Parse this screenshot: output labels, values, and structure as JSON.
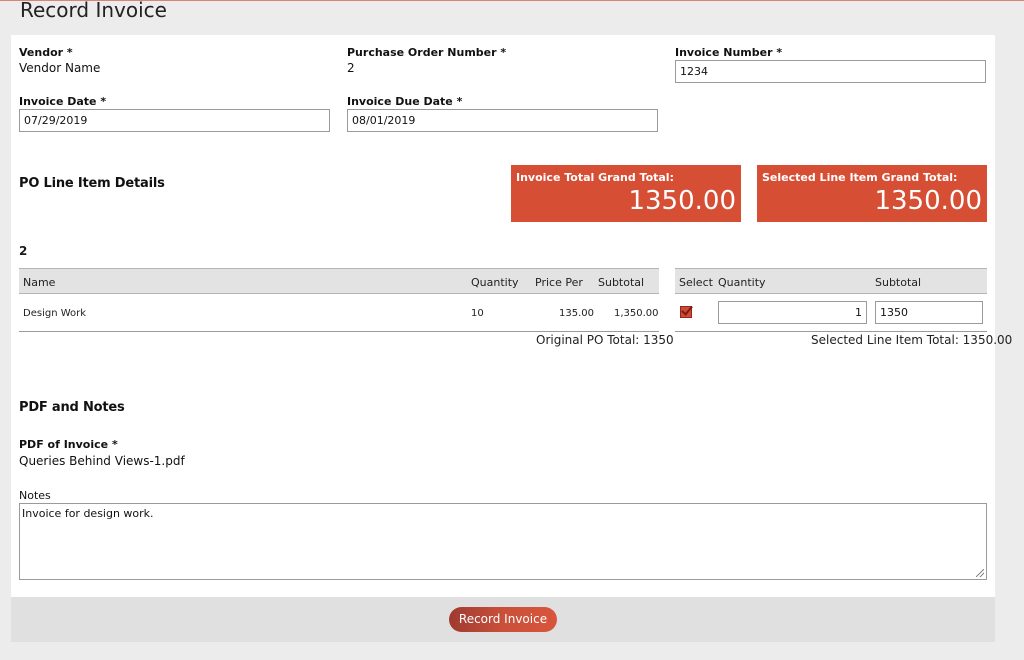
{
  "page": {
    "title": "Record Invoice"
  },
  "fields": {
    "vendor_label": "Vendor *",
    "vendor_value": "Vendor Name",
    "po_number_label": "Purchase Order Number *",
    "po_number_value": "2",
    "invoice_number_label": "Invoice Number *",
    "invoice_number_value": "1234",
    "invoice_date_label": "Invoice Date *",
    "invoice_date_value": "07/29/2019",
    "invoice_due_date_label": "Invoice Due Date *",
    "invoice_due_date_value": "08/01/2019"
  },
  "line_items": {
    "section_title": "PO Line Item Details",
    "po_id": "2",
    "kpis": [
      {
        "label": "Invoice Total Grand Total:",
        "value": "1350.00"
      },
      {
        "label": "Selected Line Item Grand Total:",
        "value": "1350.00"
      }
    ],
    "left_headers": {
      "name": "Name",
      "quantity": "Quantity",
      "price_per": "Price Per",
      "subtotal": "Subtotal"
    },
    "right_headers": {
      "select": "Select",
      "quantity": "Quantity",
      "subtotal": "Subtotal"
    },
    "rows": [
      {
        "name": "Design Work",
        "quantity": "10",
        "price_per": "135.00",
        "subtotal": "1,350.00",
        "selected": true,
        "sel_quantity": "1",
        "sel_subtotal": "1350"
      }
    ],
    "original_po_total": "Original PO Total: 1350",
    "selected_line_item_total": "Selected Line Item Total: 1350.00"
  },
  "pdf_notes": {
    "section_title": "PDF and Notes",
    "pdf_label": "PDF of Invoice *",
    "pdf_file": "Queries Behind Views-1.pdf",
    "notes_label": "Notes",
    "notes_value": "Invoice for design work."
  },
  "footer": {
    "record_button": "Record Invoice"
  },
  "colors": {
    "accent": "#d64f35",
    "button": "#c9503a"
  }
}
